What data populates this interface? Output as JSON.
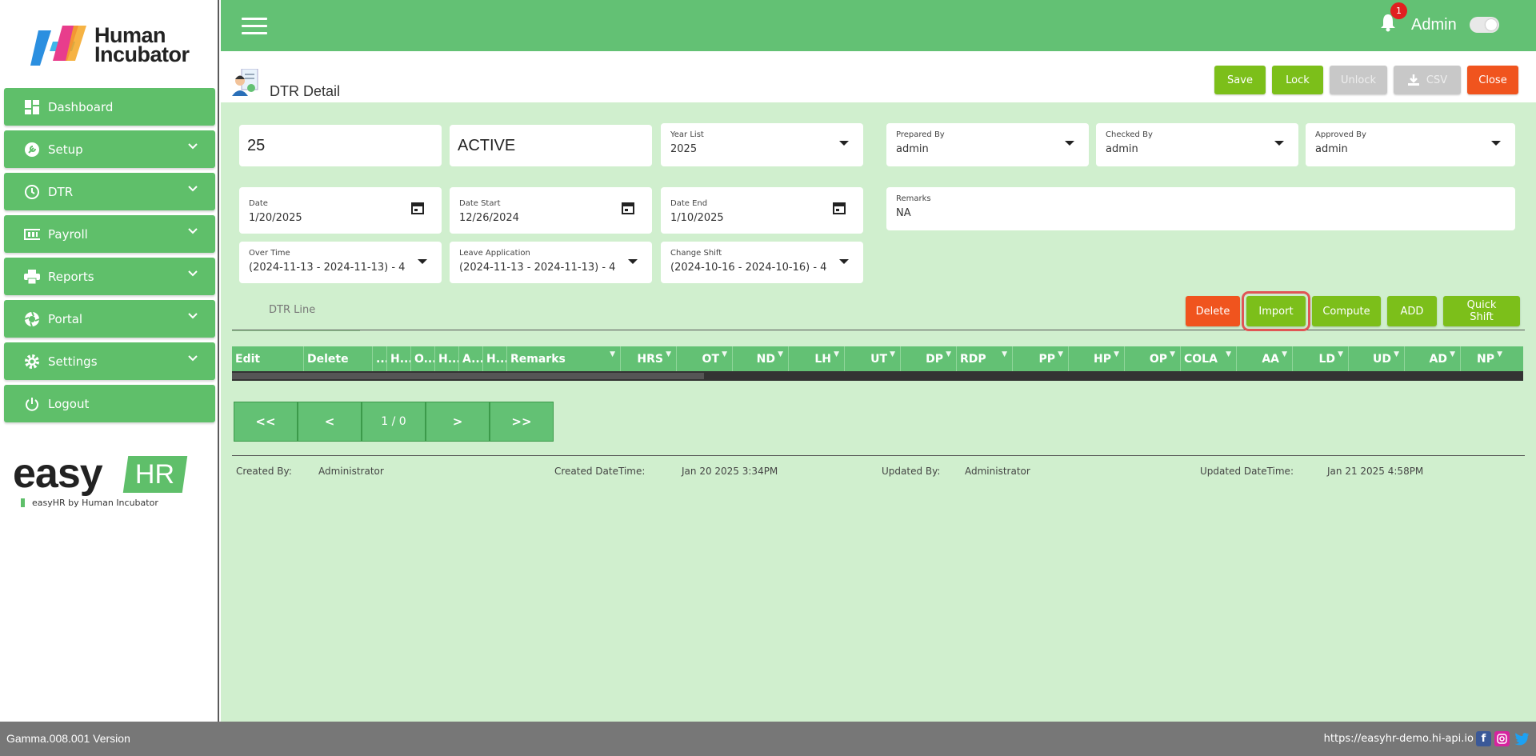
{
  "brand": {
    "logo_line1": "Human",
    "logo_line2": "Incubator",
    "easy": "easy",
    "hr": "HR",
    "sub": "easyHR by Human Incubator"
  },
  "sidebar": {
    "items": [
      {
        "label": "Dashboard"
      },
      {
        "label": "Setup"
      },
      {
        "label": "DTR"
      },
      {
        "label": "Payroll"
      },
      {
        "label": "Reports"
      },
      {
        "label": "Portal"
      },
      {
        "label": "Settings"
      },
      {
        "label": "Logout"
      }
    ]
  },
  "topbar": {
    "user": "Admin",
    "notifications": "1"
  },
  "page": {
    "title": "DTR Detail",
    "buttons": {
      "save": "Save",
      "lock": "Lock",
      "unlock": "Unlock",
      "csv": "CSV",
      "close": "Close"
    }
  },
  "form": {
    "number": "25",
    "status": "ACTIVE",
    "year_list": {
      "label": "Year List",
      "value": "2025"
    },
    "prepared_by": {
      "label": "Prepared By",
      "value": "admin"
    },
    "checked_by": {
      "label": "Checked By",
      "value": "admin"
    },
    "approved_by": {
      "label": "Approved By",
      "value": "admin"
    },
    "date": {
      "label": "Date",
      "value": "1/20/2025"
    },
    "date_start": {
      "label": "Date Start",
      "value": "12/26/2024"
    },
    "date_end": {
      "label": "Date End",
      "value": "1/10/2025"
    },
    "remarks": {
      "label": "Remarks",
      "value": "NA"
    },
    "over_time": {
      "label": "Over Time",
      "value": "(2024-11-13 - 2024-11-13) - 4"
    },
    "leave_application": {
      "label": "Leave Application",
      "value": "(2024-11-13 - 2024-11-13) - 4"
    },
    "change_shift": {
      "label": "Change Shift",
      "value": "(2024-10-16 - 2024-10-16) - 4"
    }
  },
  "tabs": {
    "dtr_line": "DTR Line"
  },
  "line_buttons": {
    "delete": "Delete",
    "import": "Import",
    "compute": "Compute",
    "add": "ADD",
    "quick_shift": "Quick Shift"
  },
  "grid": {
    "columns": [
      "Edit",
      "Delete",
      "...",
      "H...",
      "O...",
      "H...",
      "A...",
      "H...",
      "Remarks",
      "HRS",
      "OT",
      "ND",
      "LH",
      "UT",
      "DP",
      "RDP",
      "PP",
      "HP",
      "OP",
      "COLA",
      "AA",
      "LD",
      "UD",
      "AD",
      "NP"
    ]
  },
  "pager": {
    "first": "<<",
    "prev": "<",
    "info": "1 / 0",
    "next": ">",
    "last": ">>"
  },
  "meta": {
    "created_by_label": "Created By:",
    "created_by": "Administrator",
    "created_dt_label": "Created DateTime:",
    "created_dt": "Jan 20 2025 3:34PM",
    "updated_by_label": "Updated By:",
    "updated_by": "Administrator",
    "updated_dt_label": "Updated DateTime:",
    "updated_dt": "Jan 21 2025 4:58PM"
  },
  "footer": {
    "version": "Gamma.008.001 Version",
    "url": "https://easyhr-demo.hi-api.io"
  },
  "colors": {
    "primary": "#63c174",
    "button_green": "#7cbf1a",
    "danger": "#f0541e",
    "background": "#d0efce"
  }
}
